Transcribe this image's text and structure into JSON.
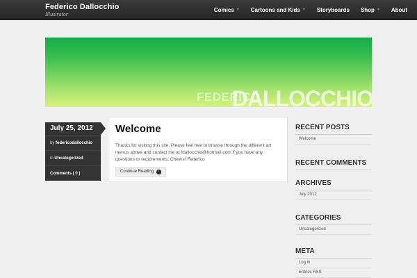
{
  "header": {
    "brand_name": "Federico Dallocchio",
    "brand_tagline": "Illustrator",
    "nav": [
      {
        "label": "Comics",
        "has_submenu": true
      },
      {
        "label": "Cartoons and Kids",
        "has_submenu": true
      },
      {
        "label": "Storyboards",
        "has_submenu": false
      },
      {
        "label": "Shop",
        "has_submenu": true
      },
      {
        "label": "About",
        "has_submenu": false
      }
    ],
    "caret": "▼"
  },
  "banner": {
    "big_text": "DALLOCCHIO",
    "small_text": "FEDERICO",
    "colors": {
      "top": "#11ad48",
      "bottom": "#d8f27c"
    }
  },
  "post_meta": {
    "date": "July 25, 2012",
    "by_prefix": "by ",
    "author": "federicodallocchio",
    "in_prefix": "in ",
    "category": "Uncategorized",
    "comments": "Comments ( 0 )"
  },
  "post": {
    "title": "Welcome",
    "body": "Thanks for visiting this site. Please feel free to browse through the different art menus above and contact me at fdallocchio@hotmail.com if you have any questions or requirements. Cheers! Federico",
    "continue_label": "Continue Reading",
    "continue_icon": "›"
  },
  "sidebar": {
    "recent_posts": {
      "title": "RECENT POSTS",
      "items": [
        "Welcome"
      ]
    },
    "recent_comments": {
      "title": "RECENT COMMENTS"
    },
    "archives": {
      "title": "ARCHIVES",
      "items": [
        "July 2012"
      ]
    },
    "categories": {
      "title": "CATEGORIES",
      "items": [
        "Uncategorized"
      ]
    },
    "meta": {
      "title": "META",
      "items": [
        "Log in",
        "Entries RSS"
      ]
    }
  }
}
